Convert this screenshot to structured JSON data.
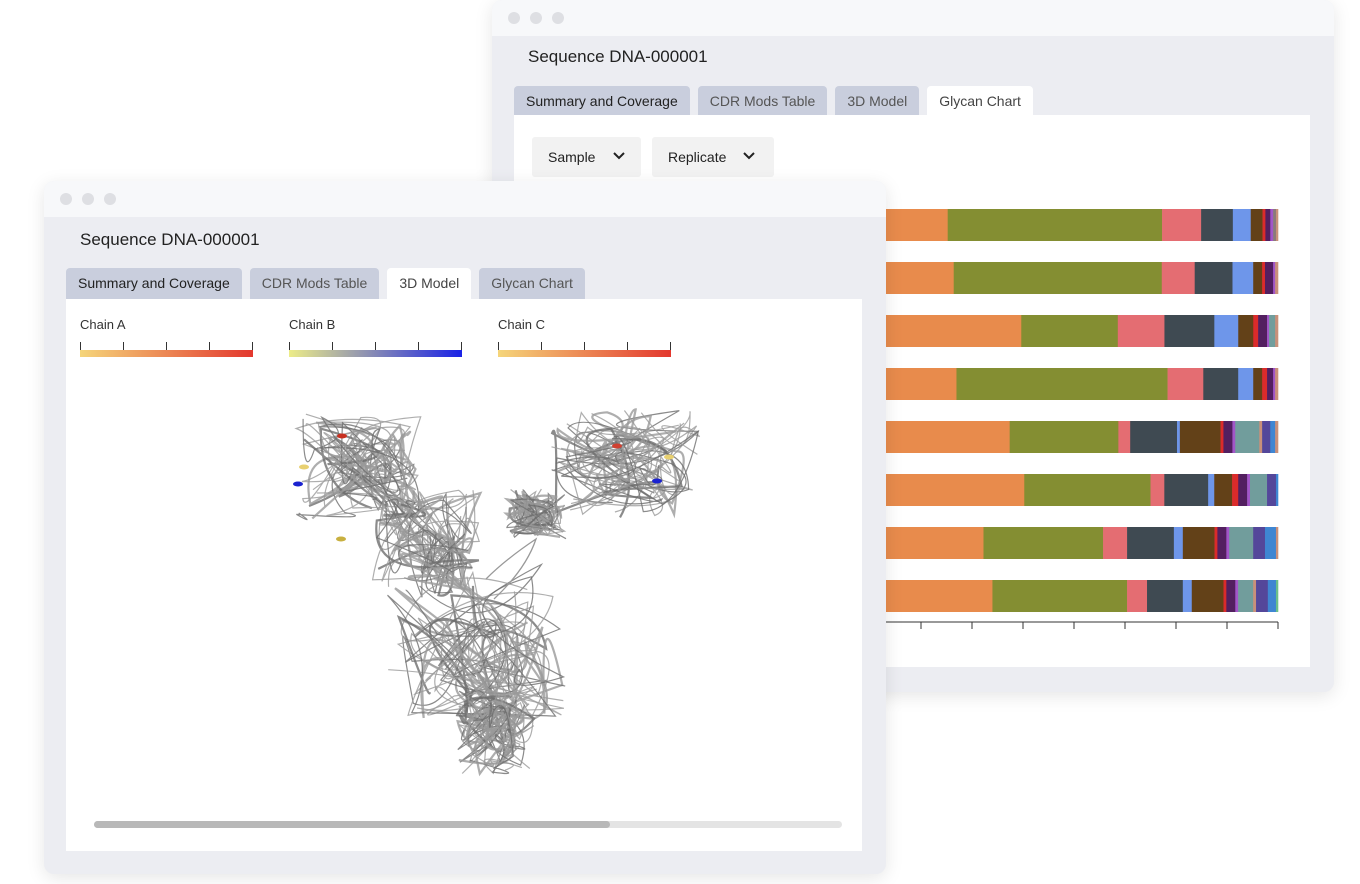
{
  "back_window": {
    "title": "Sequence DNA-000001",
    "tabs": [
      {
        "label": "Summary and Coverage"
      },
      {
        "label": "CDR Mods Table"
      },
      {
        "label": "3D Model"
      },
      {
        "label": "Glycan Chart"
      }
    ],
    "active_tab": "Glycan Chart",
    "filters": {
      "sample": "Sample",
      "replicate": "Replicate"
    }
  },
  "front_window": {
    "title": "Sequence DNA-000001",
    "tabs": [
      {
        "label": "Summary and Coverage"
      },
      {
        "label": "CDR Mods Table"
      },
      {
        "label": "3D Model"
      },
      {
        "label": "Glycan Chart"
      }
    ],
    "active_tab": "3D Model",
    "legends": [
      {
        "label": "Chain A",
        "from": "#f5d57a",
        "to": "#e3382e"
      },
      {
        "label": "Chain B",
        "from": "#ecec88",
        "to": "#1a22e6"
      },
      {
        "label": "Chain C",
        "from": "#f5d57a",
        "to": "#e3382e"
      }
    ],
    "scroll_position": 0.69
  },
  "colors": {
    "orange": "#e88b4c",
    "olive": "#848e32",
    "pink": "#e46d72",
    "dark": "#3f4a52",
    "blue": "#6e96ea",
    "brown": "#634118",
    "red": "#db2b2b",
    "purple": "#531f60",
    "violet": "#a256c8",
    "teal": "#719d9c",
    "tan": "#c9907a",
    "indigo": "#54479a",
    "azure": "#3f86d2",
    "grey": "#8a7a7a",
    "green": "#6cc08a"
  },
  "chart_data": {
    "type": "bar",
    "orientation": "horizontal-stacked",
    "xlim": [
      0,
      100
    ],
    "ticks": 8,
    "grid": false,
    "bars": [
      [
        [
          "orange",
          19.1
        ],
        [
          "olive",
          52.7
        ],
        [
          "pink",
          9.6
        ],
        [
          "dark",
          7.8
        ],
        [
          "blue",
          4.4
        ],
        [
          "brown",
          2.9
        ],
        [
          "red",
          0.7
        ],
        [
          "purple",
          1.2
        ],
        [
          "violet",
          0.7
        ],
        [
          "grey",
          0.7
        ],
        [
          "tan",
          0.5
        ]
      ],
      [
        [
          "orange",
          20.6
        ],
        [
          "olive",
          51.2
        ],
        [
          "pink",
          8.1
        ],
        [
          "dark",
          9.3
        ],
        [
          "blue",
          5.1
        ],
        [
          "brown",
          2.2
        ],
        [
          "red",
          0.7
        ],
        [
          "purple",
          2.0
        ],
        [
          "violet",
          0.5
        ],
        [
          "tan",
          0.7
        ]
      ],
      [
        [
          "orange",
          37.3
        ],
        [
          "olive",
          23.8
        ],
        [
          "pink",
          11.5
        ],
        [
          "dark",
          12.3
        ],
        [
          "blue",
          5.9
        ],
        [
          "brown",
          3.7
        ],
        [
          "red",
          1.2
        ],
        [
          "purple",
          2.2
        ],
        [
          "violet",
          0.5
        ],
        [
          "teal",
          1.5
        ],
        [
          "tan",
          0.7
        ]
      ],
      [
        [
          "orange",
          21.3
        ],
        [
          "olive",
          52.0
        ],
        [
          "pink",
          8.8
        ],
        [
          "dark",
          8.6
        ],
        [
          "blue",
          3.7
        ],
        [
          "brown",
          2.2
        ],
        [
          "red",
          1.2
        ],
        [
          "purple",
          1.5
        ],
        [
          "violet",
          0.5
        ],
        [
          "tan",
          0.7
        ]
      ],
      [
        [
          "orange",
          34.3
        ],
        [
          "olive",
          26.7
        ],
        [
          "pink",
          2.9
        ],
        [
          "dark",
          11.5
        ],
        [
          "blue",
          0.7
        ],
        [
          "brown",
          10.0
        ],
        [
          "red",
          0.7
        ],
        [
          "purple",
          2.2
        ],
        [
          "violet",
          0.7
        ],
        [
          "teal",
          5.9
        ],
        [
          "tan",
          0.7
        ],
        [
          "indigo",
          2.0
        ],
        [
          "azure",
          1.2
        ],
        [
          "tan",
          0.7
        ]
      ],
      [
        [
          "orange",
          38.0
        ],
        [
          "olive",
          31.1
        ],
        [
          "pink",
          3.4
        ],
        [
          "dark",
          10.8
        ],
        [
          "blue",
          1.5
        ],
        [
          "brown",
          4.4
        ],
        [
          "red",
          1.5
        ],
        [
          "purple",
          2.2
        ],
        [
          "violet",
          0.7
        ],
        [
          "teal",
          4.2
        ],
        [
          "indigo",
          2.2
        ],
        [
          "azure",
          0.5
        ]
      ],
      [
        [
          "orange",
          27.9
        ],
        [
          "olive",
          29.4
        ],
        [
          "pink",
          5.9
        ],
        [
          "dark",
          11.5
        ],
        [
          "blue",
          2.2
        ],
        [
          "brown",
          7.8
        ],
        [
          "red",
          0.7
        ],
        [
          "purple",
          2.2
        ],
        [
          "violet",
          0.7
        ],
        [
          "teal",
          5.9
        ],
        [
          "indigo",
          2.9
        ],
        [
          "azure",
          2.7
        ],
        [
          "tan",
          0.5
        ]
      ],
      [
        [
          "orange",
          30.1
        ],
        [
          "olive",
          33.1
        ],
        [
          "pink",
          4.9
        ],
        [
          "dark",
          8.8
        ],
        [
          "blue",
          2.2
        ],
        [
          "brown",
          7.8
        ],
        [
          "red",
          0.7
        ],
        [
          "purple",
          2.2
        ],
        [
          "violet",
          0.7
        ],
        [
          "teal",
          3.7
        ],
        [
          "tan",
          0.7
        ],
        [
          "indigo",
          2.9
        ],
        [
          "azure",
          2.0
        ],
        [
          "green",
          0.5
        ]
      ]
    ]
  }
}
